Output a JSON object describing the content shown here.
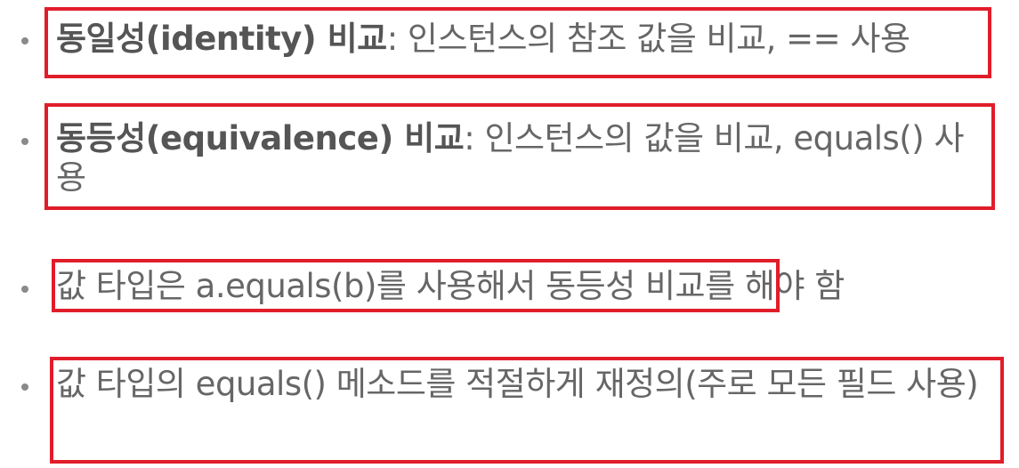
{
  "items": [
    {
      "bold": "동일성(identity) 비교",
      "rest": ": 인스턴스의 참조 값을 비교, == 사용"
    },
    {
      "bold": "동등성(equivalence) 비교",
      "rest": ": 인스턴스의 값을 비교, equals() 사용"
    },
    {
      "boxed": "값 타입은 a.equals(b)를 사용해서 동등성 비교",
      "rest": "를 해야 함"
    },
    {
      "text": "값 타입의 equals() 메소드를 적절하게 재정의(주로 모든 필드 사용)"
    }
  ],
  "colors": {
    "text": "#666666",
    "bold": "#555555",
    "highlight_box": "#e11d2a",
    "bullet": "#8a8a8a"
  }
}
